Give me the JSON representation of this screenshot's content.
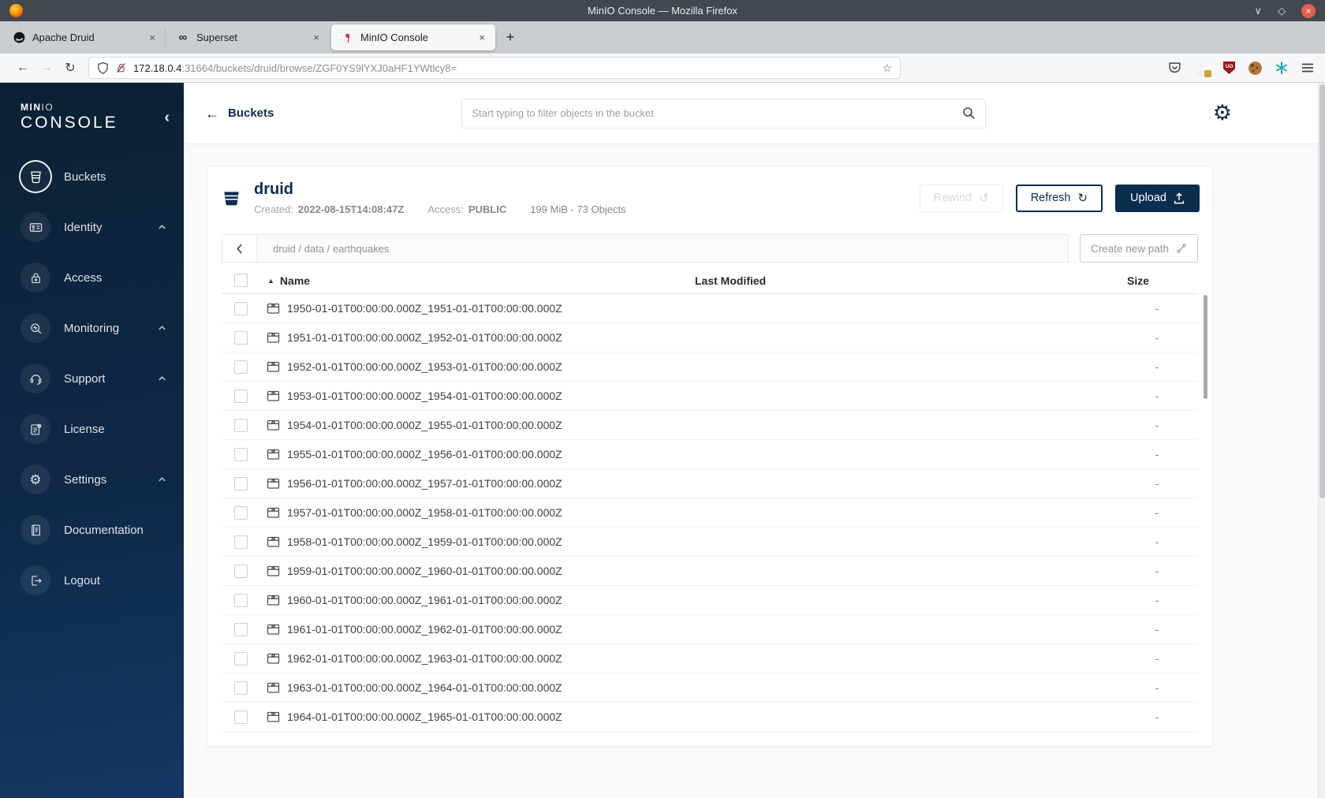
{
  "titlebar": {
    "title": "MinIO Console — Mozilla Firefox"
  },
  "tabs": [
    {
      "label": "Apache Druid"
    },
    {
      "label": "Superset"
    },
    {
      "label": "MinIO Console"
    }
  ],
  "urlbar": {
    "host": "172.18.0.4",
    "path": ":31664/buckets/druid/browse/ZGF0YS9lYXJ0aHF1YWtlcy8="
  },
  "sidebar": {
    "brand_strong": "MIN",
    "brand_light": "IO",
    "brand_bottom": "CONSOLE",
    "items": [
      {
        "label": "Buckets"
      },
      {
        "label": "Identity"
      },
      {
        "label": "Access"
      },
      {
        "label": "Monitoring"
      },
      {
        "label": "Support"
      },
      {
        "label": "License"
      },
      {
        "label": "Settings"
      },
      {
        "label": "Documentation"
      }
    ],
    "logout_label": "Logout"
  },
  "header": {
    "back_label": "Buckets",
    "search_placeholder": "Start typing to filter objects in the bucket"
  },
  "bucket": {
    "name": "druid",
    "created_label": "Created:",
    "created_value": "2022-08-15T14:08:47Z",
    "access_label": "Access:",
    "access_value": "PUBLIC",
    "summary": "199 MiB - 73 Objects",
    "rewind_label": "Rewind",
    "refresh_label": "Refresh",
    "upload_label": "Upload"
  },
  "pathbar": {
    "path": "druid / data / earthquakes",
    "create_label": "Create new path"
  },
  "table": {
    "name_header": "Name",
    "modified_header": "Last Modified",
    "size_header": "Size",
    "rows": [
      {
        "name": "1950-01-01T00:00:00.000Z_1951-01-01T00:00:00.000Z",
        "size": "-"
      },
      {
        "name": "1951-01-01T00:00:00.000Z_1952-01-01T00:00:00.000Z",
        "size": "-"
      },
      {
        "name": "1952-01-01T00:00:00.000Z_1953-01-01T00:00:00.000Z",
        "size": "-"
      },
      {
        "name": "1953-01-01T00:00:00.000Z_1954-01-01T00:00:00.000Z",
        "size": "-"
      },
      {
        "name": "1954-01-01T00:00:00.000Z_1955-01-01T00:00:00.000Z",
        "size": "-"
      },
      {
        "name": "1955-01-01T00:00:00.000Z_1956-01-01T00:00:00.000Z",
        "size": "-"
      },
      {
        "name": "1956-01-01T00:00:00.000Z_1957-01-01T00:00:00.000Z",
        "size": "-"
      },
      {
        "name": "1957-01-01T00:00:00.000Z_1958-01-01T00:00:00.000Z",
        "size": "-"
      },
      {
        "name": "1958-01-01T00:00:00.000Z_1959-01-01T00:00:00.000Z",
        "size": "-"
      },
      {
        "name": "1959-01-01T00:00:00.000Z_1960-01-01T00:00:00.000Z",
        "size": "-"
      },
      {
        "name": "1960-01-01T00:00:00.000Z_1961-01-01T00:00:00.000Z",
        "size": "-"
      },
      {
        "name": "1961-01-01T00:00:00.000Z_1962-01-01T00:00:00.000Z",
        "size": "-"
      },
      {
        "name": "1962-01-01T00:00:00.000Z_1963-01-01T00:00:00.000Z",
        "size": "-"
      },
      {
        "name": "1963-01-01T00:00:00.000Z_1964-01-01T00:00:00.000Z",
        "size": "-"
      },
      {
        "name": "1964-01-01T00:00:00.000Z_1965-01-01T00:00:00.000Z",
        "size": "-"
      }
    ]
  },
  "colors": {
    "accent_navy": "#0b2d4e",
    "sidebar_top": "#0b2134",
    "sidebar_bottom": "#143763",
    "ublock_red": "#9c1717",
    "close_button_red": "#e2604d"
  }
}
